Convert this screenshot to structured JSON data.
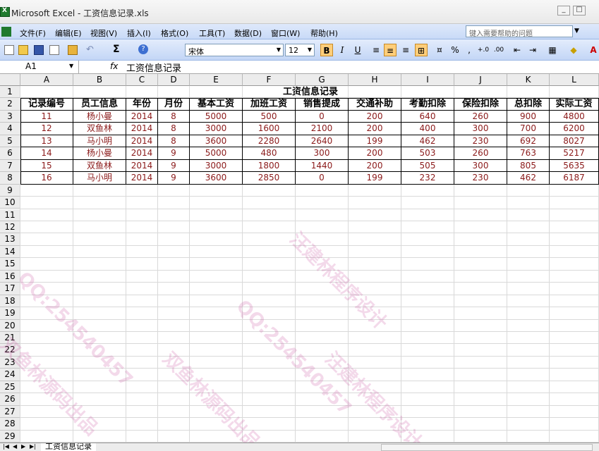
{
  "window": {
    "title": "Microsoft Excel - 工资信息记录.xls"
  },
  "menu": {
    "items": [
      "文件(F)",
      "编辑(E)",
      "视图(V)",
      "插入(I)",
      "格式(O)",
      "工具(T)",
      "数据(D)",
      "窗口(W)",
      "帮助(H)"
    ],
    "help_placeholder": "键入需要帮助的问题"
  },
  "toolbar": {
    "font": "宋体",
    "font_size": "12",
    "bold": "B",
    "italic": "I",
    "underline": "U",
    "percent": "%",
    "comma": ","
  },
  "formula_bar": {
    "name_box": "A1",
    "fx": "fx",
    "content": "工资信息记录"
  },
  "columns": [
    "A",
    "B",
    "C",
    "D",
    "E",
    "F",
    "G",
    "H",
    "I",
    "J",
    "K",
    "L"
  ],
  "rows": [
    "1",
    "2",
    "3",
    "4",
    "5",
    "6",
    "7",
    "8",
    "9",
    "10",
    "11",
    "12",
    "13",
    "14",
    "15",
    "16",
    "17",
    "18",
    "19",
    "20",
    "21",
    "22",
    "23",
    "24",
    "25",
    "26",
    "27",
    "28",
    "29"
  ],
  "table": {
    "title": "工资信息记录",
    "headers": [
      "记录编号",
      "员工信息",
      "年份",
      "月份",
      "基本工资",
      "加班工资",
      "销售提成",
      "交通补助",
      "考勤扣除",
      "保险扣除",
      "总扣除",
      "实际工资"
    ],
    "rows": [
      [
        "11",
        "杨小曼",
        "2014",
        "8",
        "5000",
        "500",
        "0",
        "200",
        "640",
        "260",
        "900",
        "4800"
      ],
      [
        "12",
        "双鱼林",
        "2014",
        "8",
        "3000",
        "1600",
        "2100",
        "200",
        "400",
        "300",
        "700",
        "6200"
      ],
      [
        "13",
        "马小明",
        "2014",
        "8",
        "3600",
        "2280",
        "2640",
        "199",
        "462",
        "230",
        "692",
        "8027"
      ],
      [
        "14",
        "杨小曼",
        "2014",
        "9",
        "5000",
        "480",
        "300",
        "200",
        "503",
        "260",
        "763",
        "5217"
      ],
      [
        "15",
        "双鱼林",
        "2014",
        "9",
        "3000",
        "1800",
        "1440",
        "200",
        "505",
        "300",
        "805",
        "5635"
      ],
      [
        "16",
        "马小明",
        "2014",
        "9",
        "3600",
        "2850",
        "0",
        "199",
        "232",
        "230",
        "462",
        "6187"
      ]
    ]
  },
  "sheet_tabs": [
    "工资信息记录"
  ],
  "watermarks": [
    "汪建林程序设计",
    "QQ:254540457",
    "双鱼林源码出品"
  ]
}
